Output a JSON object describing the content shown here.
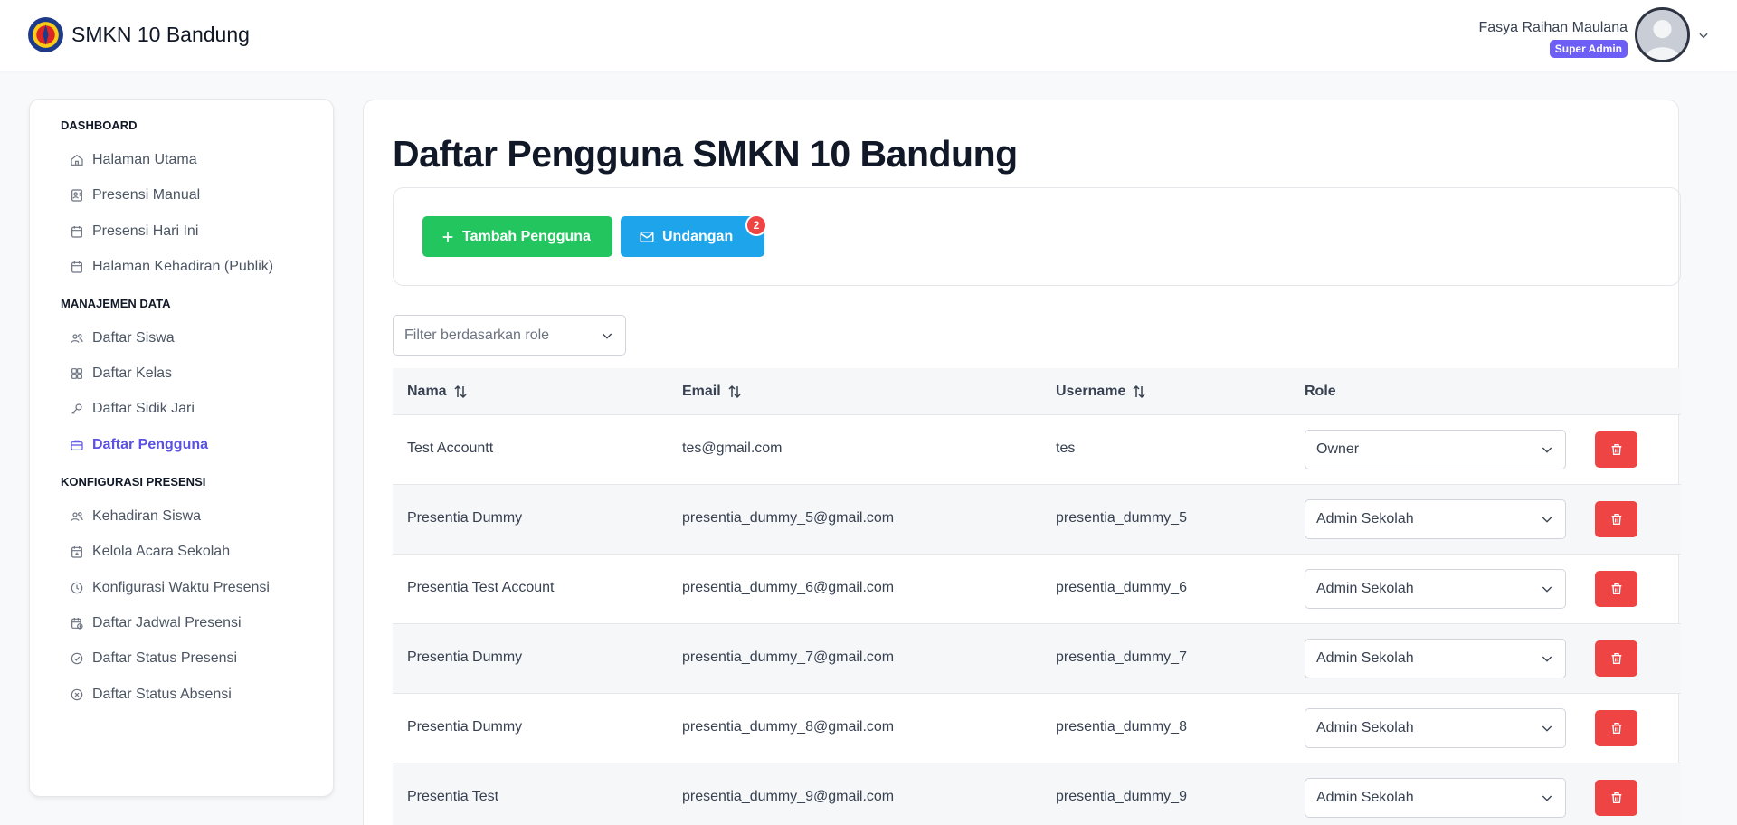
{
  "header": {
    "school_name": "SMKN 10 Bandung",
    "user_name": "Fasya Raihan Maulana",
    "user_role": "Super Admin"
  },
  "sidebar": {
    "sections": [
      {
        "title": "DASHBOARD",
        "items": [
          {
            "label": "Halaman Utama",
            "icon": "home-icon"
          },
          {
            "label": "Presensi Manual",
            "icon": "contact-icon"
          },
          {
            "label": "Presensi Hari Ini",
            "icon": "calendar-icon"
          },
          {
            "label": "Halaman Kehadiran (Publik)",
            "icon": "calendar-icon"
          }
        ]
      },
      {
        "title": "MANAJEMEN DATA",
        "items": [
          {
            "label": "Daftar Siswa",
            "icon": "users-icon"
          },
          {
            "label": "Daftar Kelas",
            "icon": "grid-icon"
          },
          {
            "label": "Daftar Sidik Jari",
            "icon": "key-icon"
          },
          {
            "label": "Daftar Pengguna",
            "icon": "briefcase-icon",
            "active": true
          }
        ]
      },
      {
        "title": "KONFIGURASI PRESENSI",
        "items": [
          {
            "label": "Kehadiran Siswa",
            "icon": "users-icon"
          },
          {
            "label": "Kelola Acara Sekolah",
            "icon": "calendar-plus-icon"
          },
          {
            "label": "Konfigurasi Waktu Presensi",
            "icon": "clock-icon"
          },
          {
            "label": "Daftar Jadwal Presensi",
            "icon": "calendar-clock-icon"
          },
          {
            "label": "Daftar Status Presensi",
            "icon": "check-circle-icon"
          },
          {
            "label": "Daftar Status Absensi",
            "icon": "x-circle-icon"
          }
        ]
      }
    ]
  },
  "main": {
    "title": "Daftar Pengguna SMKN 10 Bandung",
    "add_button": "Tambah Pengguna",
    "invite_button": "Undangan",
    "invite_badge": "2",
    "filter_placeholder": "Filter berdasarkan role",
    "columns": [
      "Nama",
      "Email",
      "Username",
      "Role"
    ],
    "rows": [
      {
        "nama": "Test Accountt",
        "email": "tes@gmail.com",
        "username": "tes",
        "role": "Owner"
      },
      {
        "nama": "Presentia Dummy",
        "email": "presentia_dummy_5@gmail.com",
        "username": "presentia_dummy_5",
        "role": "Admin Sekolah"
      },
      {
        "nama": "Presentia Test Account",
        "email": "presentia_dummy_6@gmail.com",
        "username": "presentia_dummy_6",
        "role": "Admin Sekolah"
      },
      {
        "nama": "Presentia Dummy",
        "email": "presentia_dummy_7@gmail.com",
        "username": "presentia_dummy_7",
        "role": "Admin Sekolah"
      },
      {
        "nama": "Presentia Dummy",
        "email": "presentia_dummy_8@gmail.com",
        "username": "presentia_dummy_8",
        "role": "Admin Sekolah"
      },
      {
        "nama": "Presentia Test",
        "email": "presentia_dummy_9@gmail.com",
        "username": "presentia_dummy_9",
        "role": "Admin Sekolah"
      }
    ]
  },
  "colors": {
    "accent": "#5b51e3",
    "green": "#22c55e",
    "blue": "#1ea4ea",
    "red": "#ef4444"
  }
}
